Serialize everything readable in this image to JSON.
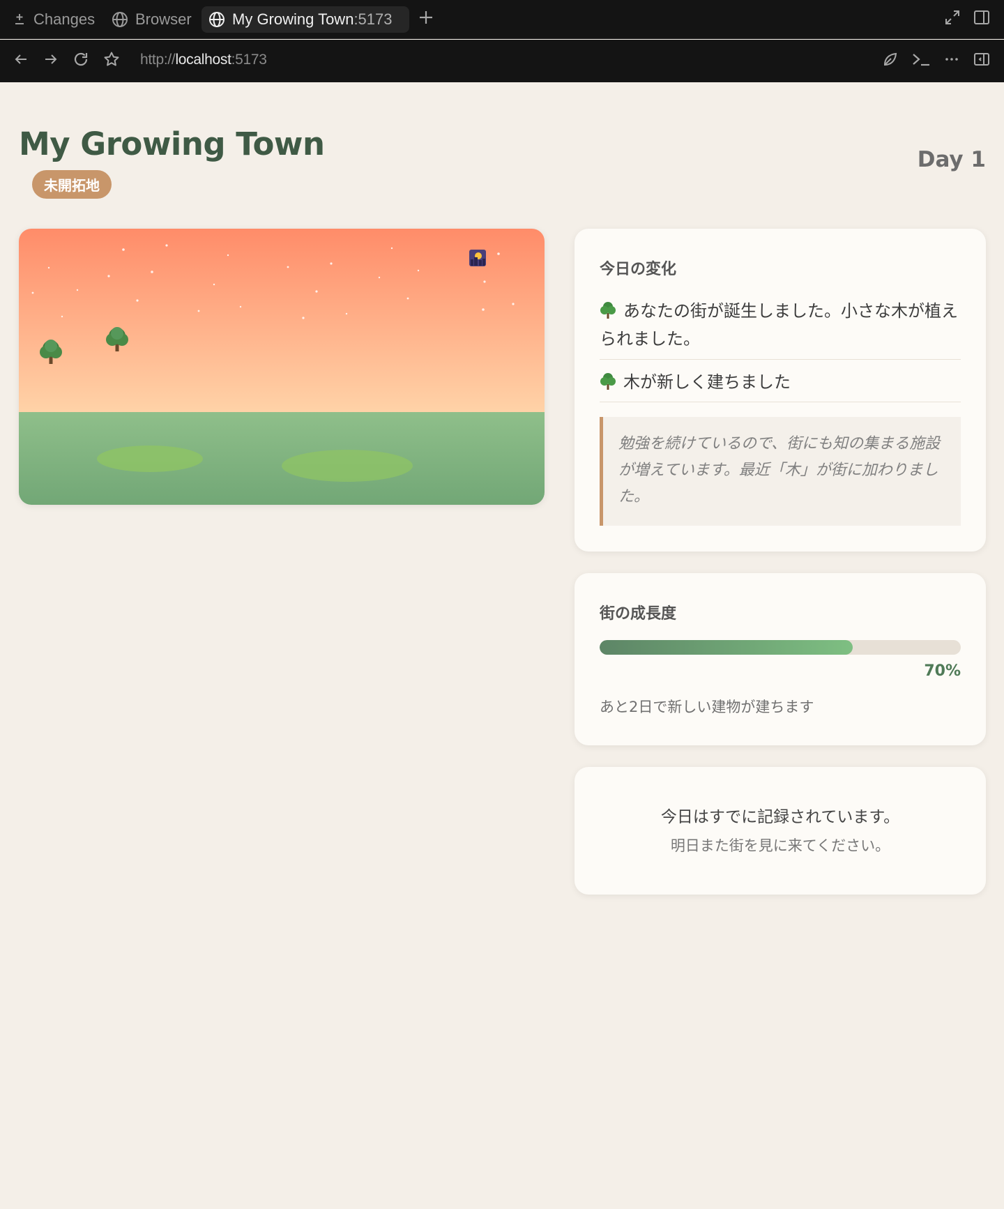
{
  "browser": {
    "tabs": [
      {
        "label": "Changes",
        "icon": "plus-minus-icon"
      },
      {
        "label": "Browser",
        "icon": "globe-icon"
      },
      {
        "label": "My Growing Town",
        "port": ":5173",
        "icon": "globe-icon",
        "active": true
      }
    ],
    "url": {
      "scheme": "http://",
      "host": "localhost",
      "port": ":5173"
    }
  },
  "header": {
    "title": "My Growing Town",
    "stage_badge": "未開拓地",
    "day": "Day 1"
  },
  "scene": {
    "sky_top_color": "#ff8c69",
    "sky_bottom_color": "#ffd3a8",
    "ground_top_color": "#8fbf8a",
    "ground_bottom_color": "#72a776",
    "tree_count": 2,
    "sun_icon": "sunset-icon"
  },
  "changes": {
    "title": "今日の変化",
    "items": [
      {
        "icon": "tree-icon",
        "text": "あなたの街が誕生しました。小さな木が植えられました。"
      },
      {
        "icon": "tree-icon",
        "text": "木が新しく建ちました"
      }
    ],
    "quote": "勉強を続けているので、街にも知の集まる施設が増えています。最近「木」が街に加わりました。"
  },
  "growth": {
    "title": "街の成長度",
    "progress": 0.7,
    "percent_label": "70%",
    "note": "あと2日で新しい建物が建ちます"
  },
  "status": {
    "message": "今日はすでに記録されています。",
    "sub": "明日また街を見に来てください。"
  },
  "colors": {
    "accent_green": "#3f5a45",
    "badge_tan": "#c8966a",
    "page_bg": "#f4efe8"
  }
}
